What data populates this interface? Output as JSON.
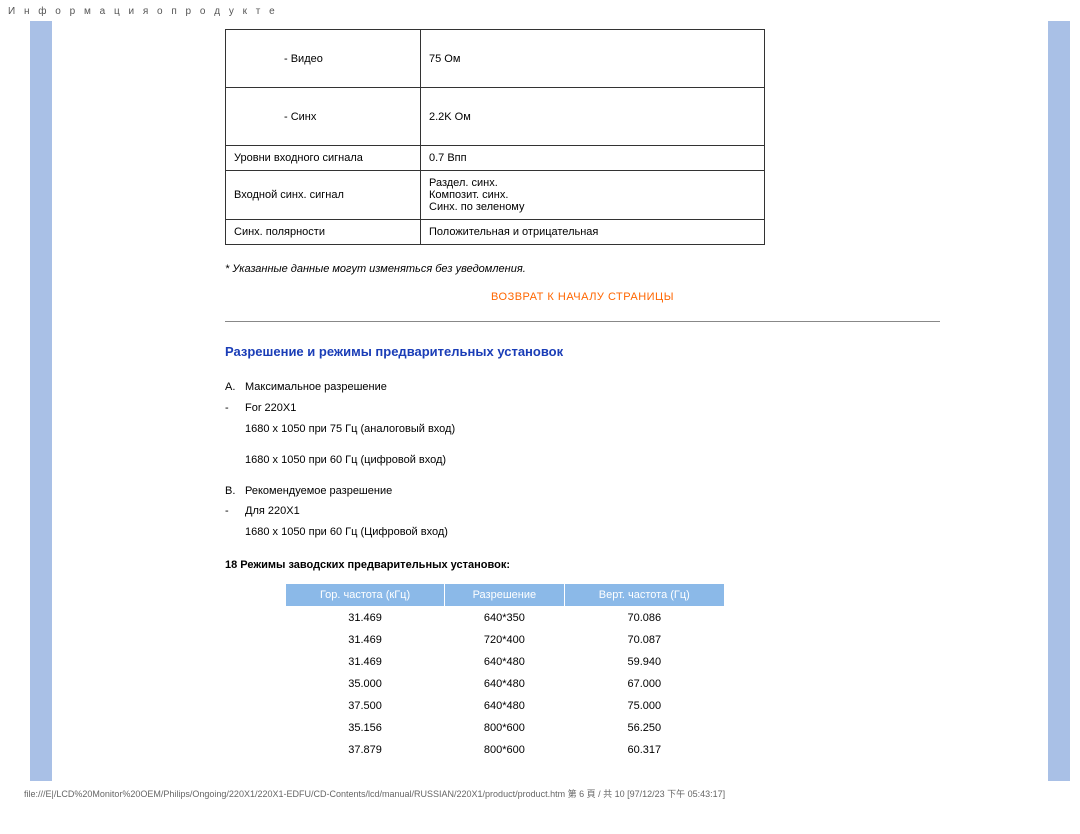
{
  "page_header": "И н ф о р м а ц и я   о   п р о д у к т е",
  "spec_table": {
    "rows": [
      {
        "label": "- Видео",
        "value": "75 Ом",
        "tall": true,
        "indent": true
      },
      {
        "label": "- Синх",
        "value": "2.2K Ом",
        "tall": true,
        "indent": true
      },
      {
        "label": "Уровни входного сигнала",
        "value": "0.7 Впп"
      },
      {
        "label": "Входной синх. сигнал",
        "value": "Раздел. синх.\nКомпозит. синх.\nСинх. по зеленому"
      },
      {
        "label": "Синх. полярности",
        "value": "Положительная и отрицательная"
      }
    ]
  },
  "note": "* Указанные данные могут изменяться без уведомления.",
  "return_link": "ВОЗВРАТ К НАЧАЛУ СТРАНИЦЫ",
  "section_heading": "Разрешение и режимы предварительных установок",
  "resolution": {
    "a_label": "A.",
    "a_text": "Максимальное разрешение",
    "a_dash": "-",
    "a_for": "For 220X1",
    "a_line1": "1680 x 1050 при 75 Гц (аналоговый вход)",
    "a_line2": "1680 x 1050 при 60 Гц (цифровой вход)",
    "b_label": "B.",
    "b_text": "Рекомендуемое разрешение",
    "b_dash": "-",
    "b_for": "Для 220X1",
    "b_line1": "1680 x 1050 при 60 Гц (Цифровой вход)"
  },
  "presets_title": "18 Режимы заводских предварительных установок:",
  "presets": {
    "headers": [
      "Гор. частота (кГц)",
      "Разрешение",
      "Верт. частота (Гц)"
    ],
    "rows": [
      [
        "31.469",
        "640*350",
        "70.086"
      ],
      [
        "31.469",
        "720*400",
        "70.087"
      ],
      [
        "31.469",
        "640*480",
        "59.940"
      ],
      [
        "35.000",
        "640*480",
        "67.000"
      ],
      [
        "37.500",
        "640*480",
        "75.000"
      ],
      [
        "35.156",
        "800*600",
        "56.250"
      ],
      [
        "37.879",
        "800*600",
        "60.317"
      ]
    ]
  },
  "footer_path": "file:///E|/LCD%20Monitor%20OEM/Philips/Ongoing/220X1/220X1-EDFU/CD-Contents/lcd/manual/RUSSIAN/220X1/product/product.htm 第 6 頁 / 共 10  [97/12/23 下午 05:43:17]"
}
